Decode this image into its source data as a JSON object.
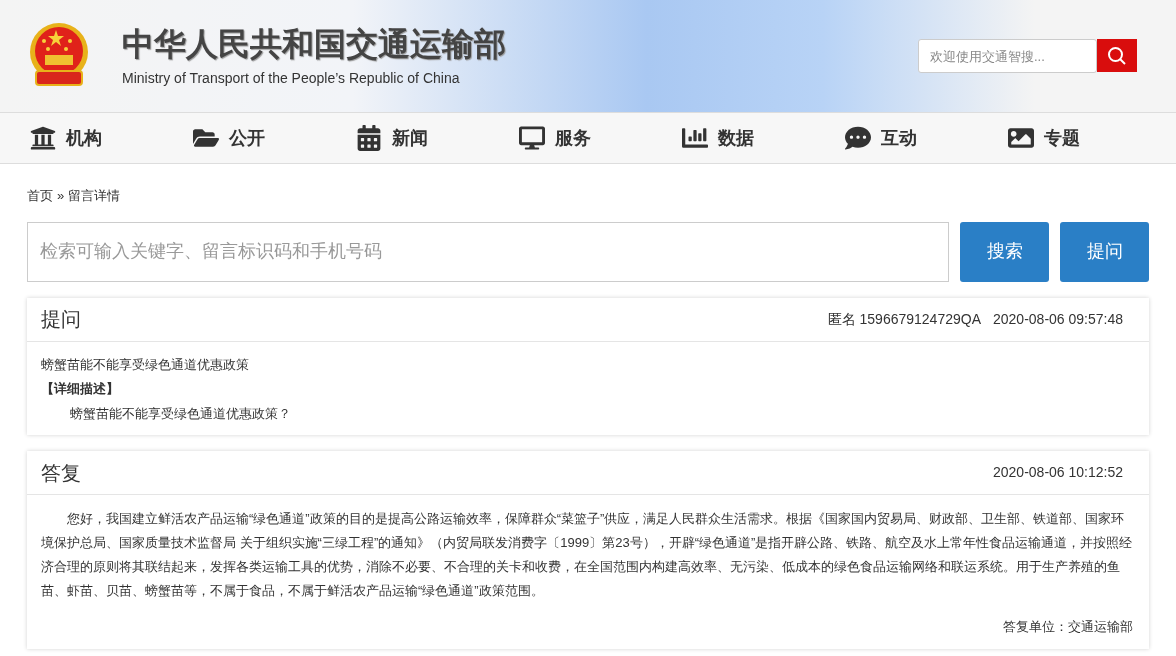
{
  "header": {
    "title": "中华人民共和国交通运输部",
    "subtitle": "Ministry of Transport of the People’s Republic of China",
    "search": {
      "placeholder": "欢迎使用交通智搜..."
    }
  },
  "nav": [
    {
      "label": "机构"
    },
    {
      "label": "公开"
    },
    {
      "label": "新闻"
    },
    {
      "label": "服务"
    },
    {
      "label": "数据"
    },
    {
      "label": "互动"
    },
    {
      "label": "专题"
    }
  ],
  "breadcrumb": {
    "home": "首页",
    "separator": "»",
    "current": "留言详情"
  },
  "search": {
    "placeholder": "检索可输入关键字、留言标识码和手机号码",
    "buttons": [
      "搜索",
      "提问"
    ]
  },
  "question": {
    "heading": "提问",
    "author": "匿名 1596679124729QA",
    "time": "2020-08-06 09:57:48",
    "title": "螃蟹苗能不能享受绿色通道优惠政策",
    "detail_label": "【详细描述】",
    "detail": "螃蟹苗能不能享受绿色通道优惠政策？"
  },
  "answer": {
    "heading": "答复",
    "time": "2020-08-06 10:12:52",
    "body": "您好，我国建立鲜活农产品运输“绿色通道”政策的目的是提高公路运输效率，保障群众“菜篮子”供应，满足人民群众生活需求。根据《国家国内贸易局、财政部、卫生部、铁道部、国家环境保护总局、国家质量技术监督局 关于组织实施“三绿工程”的通知》（内贸局联发消费字〔1999〕第23号），开辟“绿色通道”是指开辟公路、铁路、航空及水上常年性食品运输通道，并按照经济合理的原则将其联结起来，发挥各类运输工具的优势，消除不必要、不合理的关卡和收费，在全国范围内构建高效率、无污染、低成本的绿色食品运输网络和联运系统。用于生产养殖的鱼苗、虾苗、贝苗、螃蟹苗等，不属于食品，不属于鲜活农产品运输“绿色通道”政策范围。",
    "unit": "答复单位：交通运输部"
  }
}
